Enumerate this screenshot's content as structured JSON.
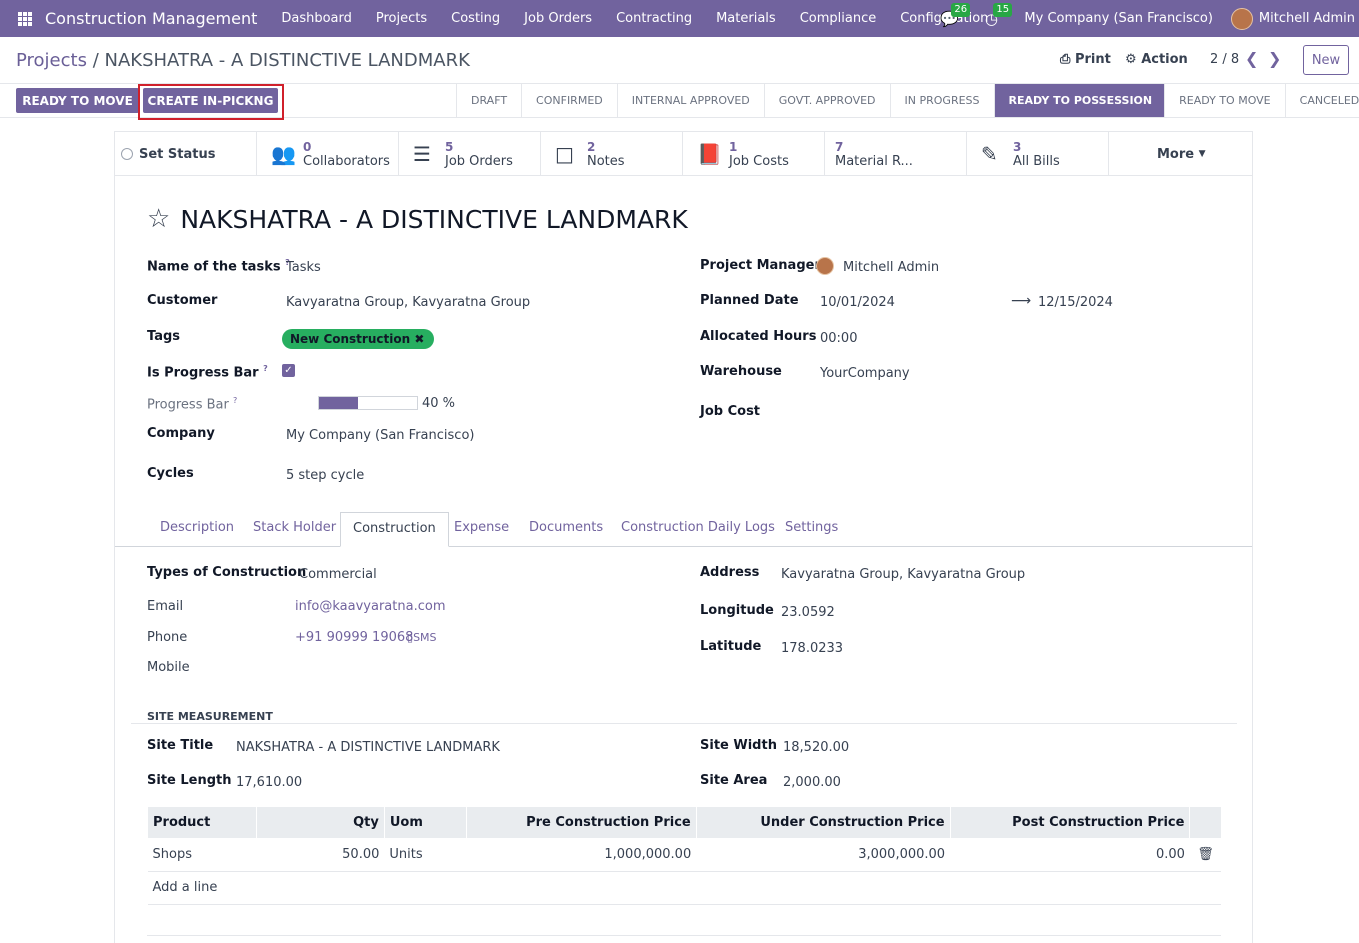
{
  "nav": {
    "app_title": "Construction Management",
    "menu": [
      "Dashboard",
      "Projects",
      "Costing",
      "Job Orders",
      "Contracting",
      "Materials",
      "Compliance",
      "Configuration"
    ],
    "messages_count": "26",
    "activities_count": "15",
    "company": "My Company (San Francisco)",
    "user": "Mitchell Admin"
  },
  "breadcrumb": {
    "parent": "Projects",
    "separator": "/",
    "current": "NAKSHATRA - A DISTINCTIVE LANDMARK"
  },
  "controls": {
    "print": "Print",
    "action": "Action",
    "pager": "2 / 8",
    "new": "New"
  },
  "buttons": {
    "ready_to_move": "READY TO MOVE",
    "create_in_picking": "CREATE IN-PICKNG"
  },
  "stages": [
    "DRAFT",
    "CONFIRMED",
    "INTERNAL APPROVED",
    "GOVT. APPROVED",
    "IN PROGRESS",
    "READY TO POSSESSION",
    "READY TO MOVE",
    "CANCELED"
  ],
  "active_stage": "READY TO POSSESSION",
  "smart": {
    "set_status": "Set Status",
    "collaborators": {
      "n": "0",
      "l": "Collaborators"
    },
    "job_orders": {
      "n": "5",
      "l": "Job Orders"
    },
    "notes": {
      "n": "2",
      "l": "Notes"
    },
    "job_costs": {
      "n": "1",
      "l": "Job Costs"
    },
    "material": {
      "n": "7",
      "l": "Material R..."
    },
    "bills": {
      "n": "3",
      "l": "All Bills"
    },
    "more": "More"
  },
  "title": "NAKSHATRA - A DISTINCTIVE LANDMARK",
  "fields": {
    "name_tasks_label": "Name of the tasks",
    "name_tasks": "Tasks",
    "customer_label": "Customer",
    "customer": "Kavyaratna Group, Kavyaratna Group",
    "tags_label": "Tags",
    "tag": "New Construction",
    "is_progress_label": "Is Progress Bar",
    "progress_label": "Progress Bar",
    "progress_text": "40 %",
    "progress_value": 0.4,
    "company_label": "Company",
    "company": "My Company (San Francisco)",
    "cycles_label": "Cycles",
    "cycles": "5 step cycle",
    "pm_label": "Project Manager",
    "pm": "Mitchell Admin",
    "planned_label": "Planned Date",
    "planned_start": "10/01/2024",
    "planned_end": "12/15/2024",
    "alloc_label": "Allocated Hours",
    "alloc": "00:00",
    "warehouse_label": "Warehouse",
    "warehouse": "YourCompany",
    "jobcost_label": "Job Cost"
  },
  "tabs": [
    "Description",
    "Stack Holder",
    "Construction",
    "Expense",
    "Documents",
    "Construction Daily Logs",
    "Settings"
  ],
  "construction": {
    "types_label": "Types of Construction",
    "types": "Commercial",
    "email_label": "Email",
    "email": "info@kaavyaratna.com",
    "phone_label": "Phone",
    "phone": "+91 90999 19068",
    "sms": "SMS",
    "mobile_label": "Mobile",
    "address_label": "Address",
    "address": "Kavyaratna Group, Kavyaratna Group",
    "longitude_label": "Longitude",
    "longitude": "23.0592",
    "latitude_label": "Latitude",
    "latitude": "178.0233"
  },
  "site": {
    "heading": "SITE MEASUREMENT",
    "title_label": "Site Title",
    "title": "NAKSHATRA - A DISTINCTIVE LANDMARK",
    "length_label": "Site Length",
    "length": "17,610.00",
    "width_label": "Site Width",
    "width": "18,520.00",
    "area_label": "Site Area",
    "area": "2,000.00"
  },
  "table": {
    "headers": [
      "Product",
      "Qty",
      "Uom",
      "Pre Construction Price",
      "Under Construction Price",
      "Post Construction Price"
    ],
    "rows": [
      [
        "Shops",
        "50.00",
        "Units",
        "1,000,000.00",
        "3,000,000.00",
        "0.00"
      ]
    ],
    "add_line": "Add a line"
  }
}
